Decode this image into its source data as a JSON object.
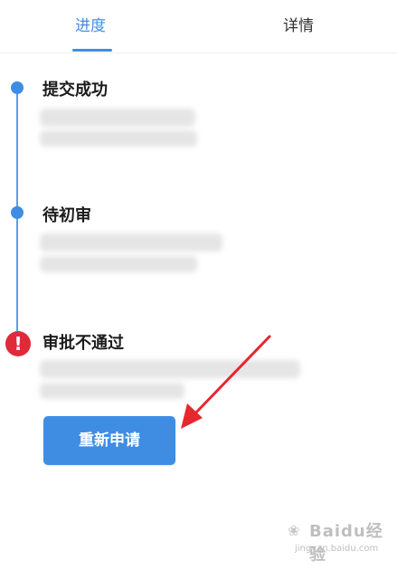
{
  "tabs": [
    {
      "label": "进度",
      "active": true
    },
    {
      "label": "详情",
      "active": false
    }
  ],
  "timeline": [
    {
      "title": "提交成功",
      "status": "done"
    },
    {
      "title": "待初审",
      "status": "done"
    },
    {
      "title": "审批不通过",
      "status": "error"
    }
  ],
  "action": {
    "resubmit_label": "重新申请"
  },
  "watermark": {
    "site": "jingyan.baidu.com",
    "brand": "Baidu经验"
  },
  "colors": {
    "accent": "#3f8de3",
    "error": "#e02a3a",
    "arrow": "#e8262d"
  }
}
